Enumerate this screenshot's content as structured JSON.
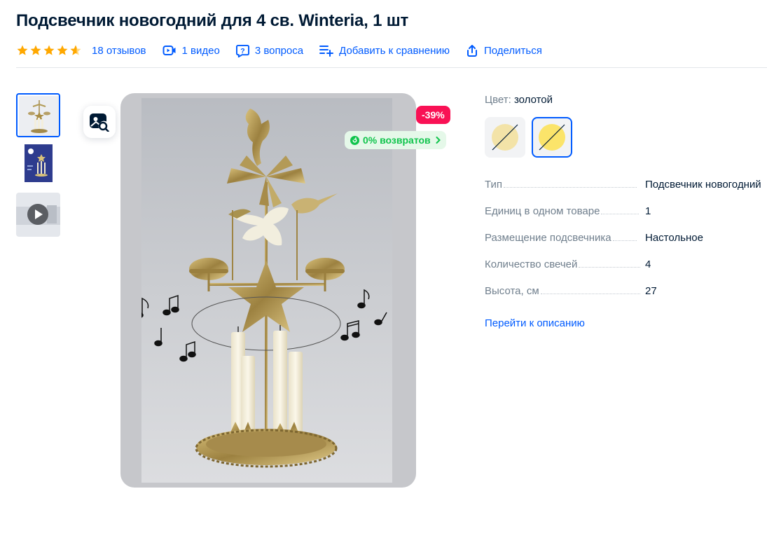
{
  "product": {
    "title": "Подсвечник новогодний для 4 св. Winteria, 1 шт",
    "rating": 4.5
  },
  "meta": {
    "reviews": "18 отзывов",
    "videos": "1 видео",
    "questions": "3 вопроса",
    "compare": "Добавить к сравнению",
    "share": "Поделиться"
  },
  "badges": {
    "discount": "-39%",
    "returns": "0% возвратов"
  },
  "color": {
    "label": "Цвет:",
    "value": "золотой"
  },
  "specs": [
    {
      "key": "Тип",
      "value": "Подсвечник новогодний"
    },
    {
      "key": "Единиц в одном товаре",
      "value": "1"
    },
    {
      "key": "Размещение подсвечника",
      "value": "Настольное"
    },
    {
      "key": "Количество свечей",
      "value": "4"
    },
    {
      "key": "Высота, см",
      "value": "27"
    }
  ],
  "description_link": "Перейти к описанию",
  "colors": {
    "accent": "#005bff",
    "star": "#ffa800",
    "discount": "#f91155",
    "returns": "#10c44c"
  }
}
